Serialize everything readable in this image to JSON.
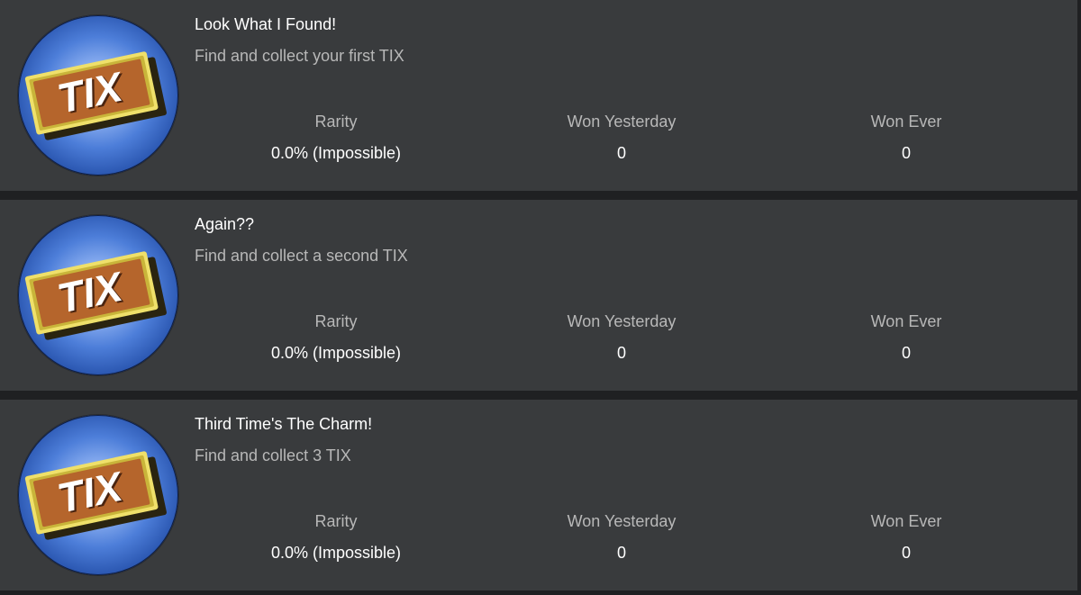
{
  "badges": [
    {
      "icon": "tix-badge-icon",
      "title": "Look What I Found!",
      "description": "Find and collect your first TIX",
      "stats": {
        "rarity_label": "Rarity",
        "rarity_value": "0.0% (Impossible)",
        "won_yesterday_label": "Won Yesterday",
        "won_yesterday_value": "0",
        "won_ever_label": "Won Ever",
        "won_ever_value": "0"
      }
    },
    {
      "icon": "tix-badge-icon",
      "title": "Again??",
      "description": "Find and collect a second TIX",
      "stats": {
        "rarity_label": "Rarity",
        "rarity_value": "0.0% (Impossible)",
        "won_yesterday_label": "Won Yesterday",
        "won_yesterday_value": "0",
        "won_ever_label": "Won Ever",
        "won_ever_value": "0"
      }
    },
    {
      "icon": "tix-badge-icon",
      "title": "Third Time's The Charm!",
      "description": "Find and collect 3 TIX",
      "stats": {
        "rarity_label": "Rarity",
        "rarity_value": "0.0% (Impossible)",
        "won_yesterday_label": "Won Yesterday",
        "won_yesterday_value": "0",
        "won_ever_label": "Won Ever",
        "won_ever_value": "0"
      }
    }
  ],
  "tix_logo_text": "TIX",
  "colors": {
    "card_background": "#393b3d",
    "page_background": "#1f2022",
    "title_text": "#ffffff",
    "secondary_text": "#b8b8b8",
    "ticket_brown": "#b5652c",
    "ticket_gold": "#e8d34a"
  }
}
